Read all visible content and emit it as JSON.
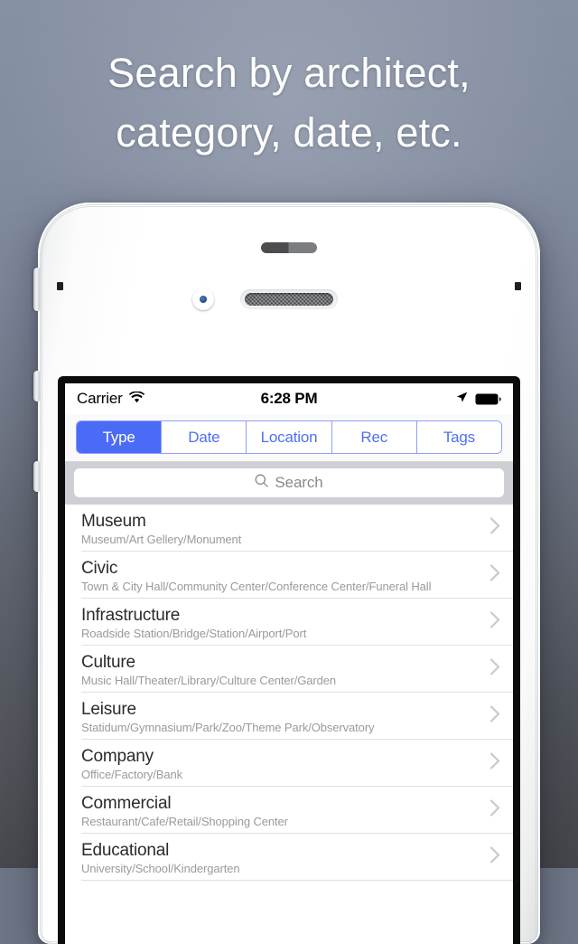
{
  "headline": {
    "line1": "Search by architect,",
    "line2": "category, date, etc."
  },
  "colors": {
    "accent": "#4a6bf5",
    "segment_border": "#8da0f5",
    "search_bar_bg": "#cdcfd4",
    "row_title": "#2b2b2d",
    "row_subtitle": "#9a9a9e",
    "separator": "#e0e0e2",
    "background_top": "#8791a4",
    "background_bottom": "#45464b"
  },
  "status_bar": {
    "carrier": "Carrier",
    "wifi_icon": "wifi-icon",
    "time": "6:28 PM",
    "location_icon": "location-arrow-icon",
    "battery_icon": "battery-full-icon"
  },
  "segmented_control": {
    "selected_index": 0,
    "segments": [
      {
        "label": "Type"
      },
      {
        "label": "Date"
      },
      {
        "label": "Location"
      },
      {
        "label": "Rec"
      },
      {
        "label": "Tags"
      }
    ]
  },
  "search": {
    "icon": "search-icon",
    "placeholder": "Search",
    "value": ""
  },
  "category_list": {
    "rows": [
      {
        "title": "Museum",
        "subtitle": "Museum/Art Gellery/Monument",
        "chevron": "chevron-right-icon"
      },
      {
        "title": "Civic",
        "subtitle": "Town & City Hall/Community Center/Conference Center/Funeral Hall",
        "chevron": "chevron-right-icon"
      },
      {
        "title": "Infrastructure",
        "subtitle": "Roadside Station/Bridge/Station/Airport/Port",
        "chevron": "chevron-right-icon"
      },
      {
        "title": "Culture",
        "subtitle": "Music Hall/Theater/Library/Culture Center/Garden",
        "chevron": "chevron-right-icon"
      },
      {
        "title": "Leisure",
        "subtitle": "Statidum/Gymnasium/Park/Zoo/Theme Park/Observatory",
        "chevron": "chevron-right-icon"
      },
      {
        "title": "Company",
        "subtitle": "Office/Factory/Bank",
        "chevron": "chevron-right-icon"
      },
      {
        "title": "Commercial",
        "subtitle": "Restaurant/Cafe/Retail/Shopping Center",
        "chevron": "chevron-right-icon"
      },
      {
        "title": "Educational",
        "subtitle": "University/School/Kindergarten",
        "chevron": "chevron-right-icon"
      }
    ]
  },
  "device": {
    "sensor_bar": "proximity-sensor",
    "camera": "front-camera",
    "earpiece": "earpiece-speaker",
    "buttons": [
      "silent-switch",
      "volume-up-button",
      "volume-down-button"
    ]
  }
}
